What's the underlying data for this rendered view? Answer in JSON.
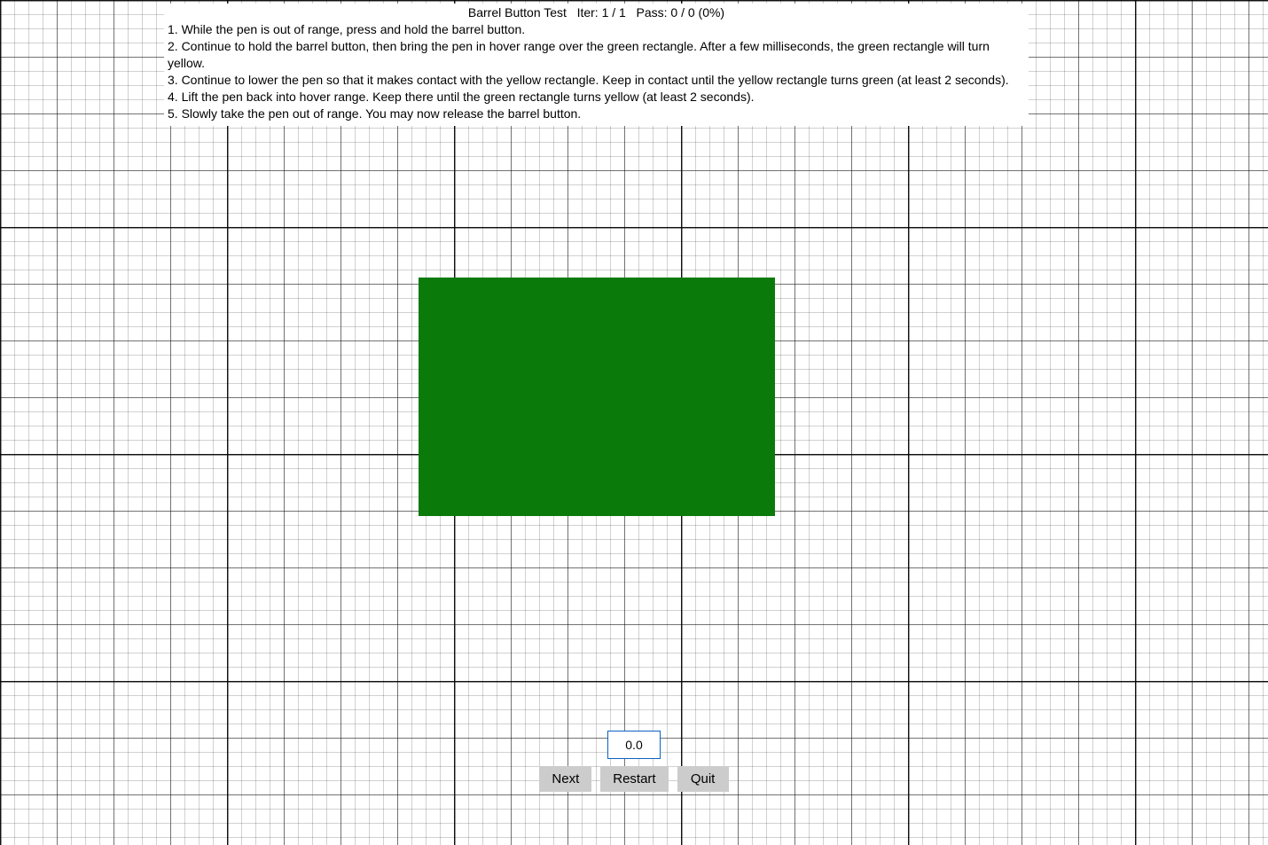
{
  "header": {
    "title": "Barrel Button Test   Iter: 1 / 1   Pass: 0 / 0 (0%)"
  },
  "instructions": {
    "items": [
      "1. While the pen is out of range, press and hold the barrel button.",
      "2. Continue to hold the barrel button, then bring the pen in hover range over the green rectangle. After a few milliseconds, the green rectangle will turn yellow.",
      "3. Continue to lower the pen so that it makes contact with the yellow rectangle. Keep in contact until the yellow rectangle turns green (at least 2 seconds).",
      "4. Lift the pen back into hover range. Keep there until the green rectangle turns yellow (at least 2 seconds).",
      "5. Slowly take the pen out of range. You may now release the barrel button."
    ]
  },
  "target": {
    "color": "#0a7a0a"
  },
  "readout": {
    "value": "0.0"
  },
  "buttons": {
    "next": "Next",
    "restart": "Restart",
    "quit": "Quit"
  }
}
